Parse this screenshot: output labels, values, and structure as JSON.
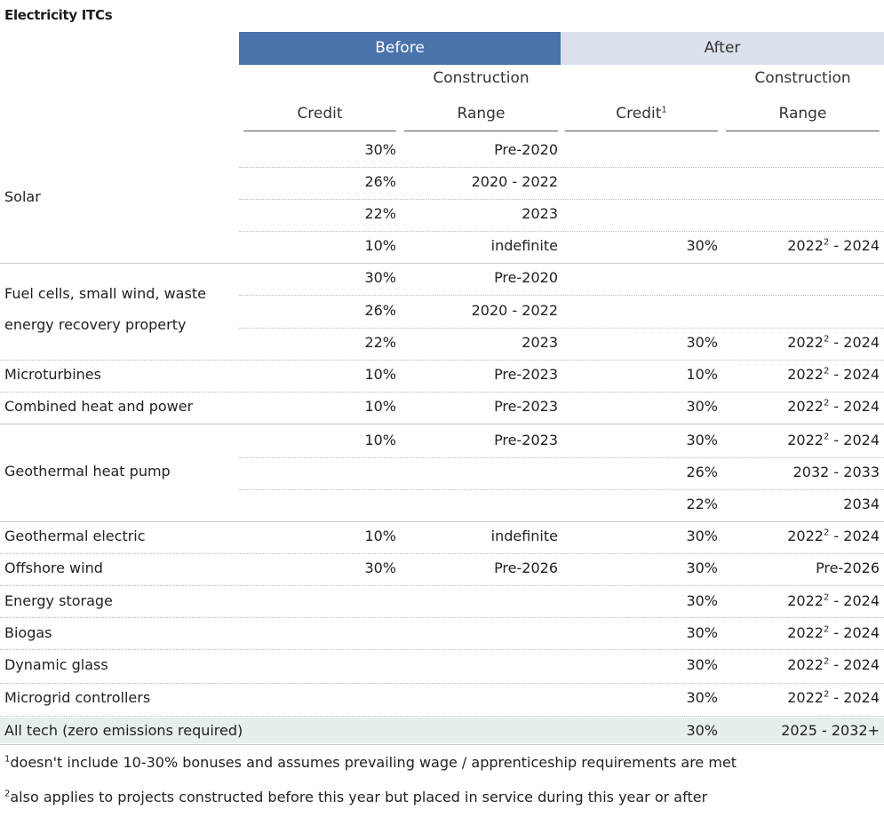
{
  "title": "Electricity ITCs",
  "headers": {
    "before": "Before",
    "after": "After",
    "construction": "Construction",
    "credit": "Credit",
    "range": "Range",
    "credit_note": "1"
  },
  "labels": {
    "solar": "Solar",
    "fuel_1": "Fuel cells, small wind, waste",
    "fuel_2": "energy recovery property",
    "micro": "Microturbines",
    "chp": "Combined heat and power",
    "geo_hp": "Geothermal heat pump",
    "geo_el": "Geothermal electric",
    "offshore": "Offshore wind",
    "storage": "Energy storage",
    "biogas": "Biogas",
    "glass": "Dynamic glass",
    "microgrid": "Microgrid controllers",
    "all_tech": "All tech (zero emissions required)"
  },
  "rows": [
    {
      "bc": "30%",
      "br": "Pre-2020",
      "ac": "",
      "ar": "",
      "ar_sup": "",
      "ar_tail": ""
    },
    {
      "bc": "26%",
      "br": "2020 - 2022",
      "ac": "",
      "ar": "",
      "ar_sup": "",
      "ar_tail": ""
    },
    {
      "bc": "22%",
      "br": "2023",
      "ac": "",
      "ar": "",
      "ar_sup": "",
      "ar_tail": ""
    },
    {
      "bc": "10%",
      "br": "indefinite",
      "ac": "30%",
      "ar": "2022",
      "ar_sup": "2",
      "ar_tail": " - 2024"
    },
    {
      "bc": "30%",
      "br": "Pre-2020",
      "ac": "",
      "ar": "",
      "ar_sup": "",
      "ar_tail": ""
    },
    {
      "bc": "26%",
      "br": "2020 - 2022",
      "ac": "",
      "ar": "",
      "ar_sup": "",
      "ar_tail": ""
    },
    {
      "bc": "22%",
      "br": "2023",
      "ac": "30%",
      "ar": "2022",
      "ar_sup": "2",
      "ar_tail": " - 2024"
    },
    {
      "bc": "10%",
      "br": "Pre-2023",
      "ac": "10%",
      "ar": "2022",
      "ar_sup": "2",
      "ar_tail": " - 2024"
    },
    {
      "bc": "10%",
      "br": "Pre-2023",
      "ac": "30%",
      "ar": "2022",
      "ar_sup": "2",
      "ar_tail": " - 2024"
    },
    {
      "bc": "10%",
      "br": "Pre-2023",
      "ac": "30%",
      "ar": "2022",
      "ar_sup": "2",
      "ar_tail": " - 2024"
    },
    {
      "bc": "",
      "br": "",
      "ac": "26%",
      "ar": "2032 - 2033",
      "ar_sup": "",
      "ar_tail": ""
    },
    {
      "bc": "",
      "br": "",
      "ac": "22%",
      "ar": "2034",
      "ar_sup": "",
      "ar_tail": ""
    },
    {
      "bc": "10%",
      "br": "indefinite",
      "ac": "30%",
      "ar": "2022",
      "ar_sup": "2",
      "ar_tail": " - 2024"
    },
    {
      "bc": "30%",
      "br": "Pre-2026",
      "ac": "30%",
      "ar": "Pre-2026",
      "ar_sup": "",
      "ar_tail": ""
    },
    {
      "bc": "",
      "br": "",
      "ac": "30%",
      "ar": "2022",
      "ar_sup": "2",
      "ar_tail": " - 2024"
    },
    {
      "bc": "",
      "br": "",
      "ac": "30%",
      "ar": "2022",
      "ar_sup": "2",
      "ar_tail": " - 2024"
    },
    {
      "bc": "",
      "br": "",
      "ac": "30%",
      "ar": "2022",
      "ar_sup": "2",
      "ar_tail": " - 2024"
    },
    {
      "bc": "",
      "br": "",
      "ac": "30%",
      "ar": "2022",
      "ar_sup": "2",
      "ar_tail": " - 2024"
    },
    {
      "bc": "",
      "br": "",
      "ac": "30%",
      "ar": "2025 - 2032+",
      "ar_sup": "",
      "ar_tail": ""
    }
  ],
  "footnotes": [
    {
      "mark": "1",
      "text": "doesn't include 10-30% bonuses and assumes prevailing wage / apprenticeship requirements are met"
    },
    {
      "mark": "2",
      "text": "also applies to projects constructed before this year but placed in service during this year or after"
    }
  ],
  "colors": {
    "before_header": "#4a73ac",
    "after_header": "#dbe2ee",
    "highlight_row": "#e6efec"
  }
}
